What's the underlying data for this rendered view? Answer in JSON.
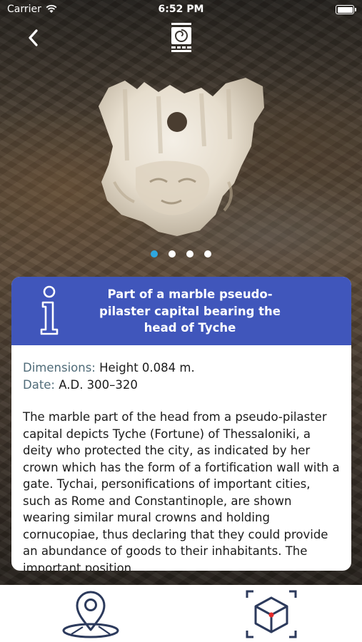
{
  "status_bar": {
    "carrier": "Carrier",
    "time": "6:52 PM"
  },
  "carousel": {
    "page_count": 4,
    "active_index": 0
  },
  "card": {
    "title": "Part of a marble pseudo-pilaster capital bearing the head of Tyche",
    "dimensions_label": "Dimensions:",
    "dimensions_value": "Height 0.084 m.",
    "date_label": "Date:",
    "date_value": "A.D. 300–320",
    "description": "The marble part of the head from a pseudo-pilaster capital depicts Tyche (Fortune) of Thessaloniki, a deity who protected the city, as indicated by her crown which has the form of a fortification wall with a gate. Tychai, personifications of important cities, such as Rome and Constantinople, are shown wearing similar mural crowns and holding cornucopiae, thus declaring that they could provide an abundance of goods to their inhabitants. The important position"
  },
  "icons": {
    "back": "chevron-left-icon",
    "logo": "app-logo",
    "info": "info-icon",
    "map": "map-pin-icon",
    "ar": "ar-cube-icon"
  },
  "colors": {
    "header_blue": "#4056bb",
    "dot_active": "#2ea7e0",
    "label_gray": "#4f6b78"
  }
}
